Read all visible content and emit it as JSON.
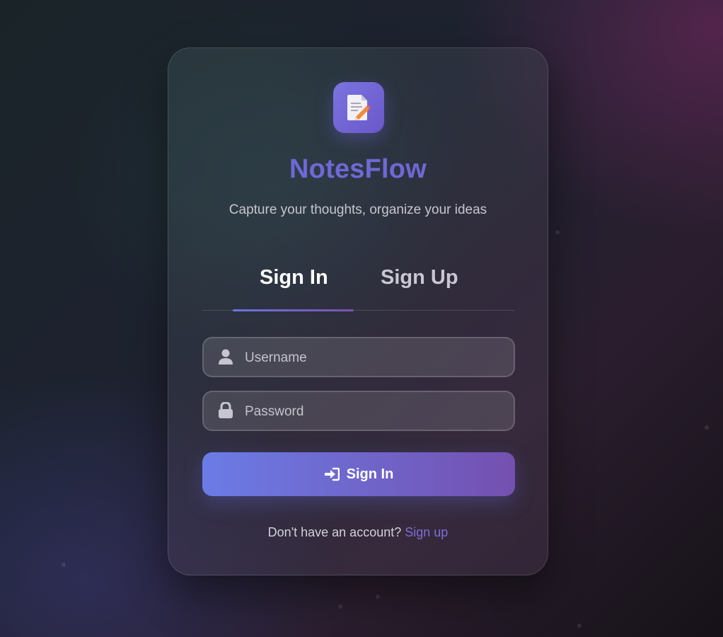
{
  "app": {
    "name": "NotesFlow",
    "tagline": "Capture your thoughts, organize your ideas",
    "logo_icon": "notepad-pencil-icon"
  },
  "tabs": [
    {
      "label": "Sign In",
      "active": true
    },
    {
      "label": "Sign Up",
      "active": false
    }
  ],
  "form": {
    "username": {
      "placeholder": "Username",
      "value": "",
      "icon": "user-icon"
    },
    "password": {
      "placeholder": "Password",
      "value": "",
      "icon": "lock-icon"
    },
    "submit_label": "Sign In",
    "submit_icon": "sign-in-icon"
  },
  "footer": {
    "prompt": "Don't have an account?",
    "link_label": "Sign up"
  },
  "colors": {
    "accent": "#6f68d6",
    "button_gradient_start": "#6b7ce6",
    "button_gradient_end": "#7450b0",
    "link": "#7b6ed8"
  }
}
